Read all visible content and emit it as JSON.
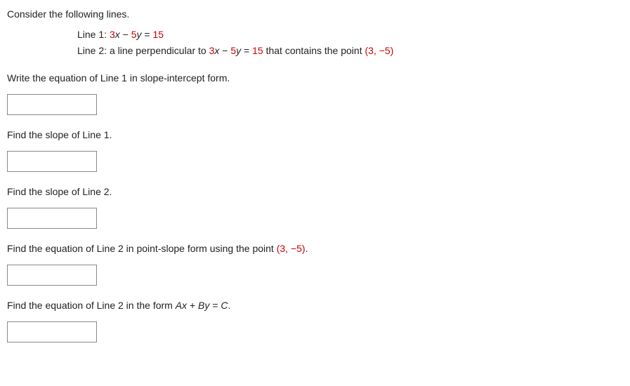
{
  "intro": "Consider the following lines.",
  "lines": {
    "line1": {
      "label": "Line 1: ",
      "eq_pre_num1": "3",
      "eq_var1": "x",
      "eq_mid": " − ",
      "eq_pre_num2": "5",
      "eq_var2": "y",
      "eq_eqs": " = ",
      "eq_rhs": "15"
    },
    "line2": {
      "label": "Line 2: ",
      "text_a": "a line perpendicular to ",
      "eq_pre_num1": "3",
      "eq_var1": "x",
      "eq_mid": " − ",
      "eq_pre_num2": "5",
      "eq_var2": "y",
      "eq_eqs": " = ",
      "eq_rhs": "15",
      "text_b": " that contains the point ",
      "pt_open": "(",
      "pt_x": "3",
      "pt_sep": ", ",
      "pt_y": "−5",
      "pt_close": ")"
    }
  },
  "q1": "Write the equation of Line 1 in slope-intercept form.",
  "q2": "Find the slope of Line 1.",
  "q3": "Find the slope of Line 2.",
  "q4": {
    "pre": "Find the equation of Line 2 in point-slope form using the point ",
    "pt_open": "(",
    "pt_x": "3",
    "pt_sep": ", ",
    "pt_y": "−5",
    "pt_close": ")",
    "end": "."
  },
  "q5": {
    "pre": "Find the equation of Line 2 in the form ",
    "varA": "Ax",
    "plus": " + ",
    "varB": "By",
    "eqs": " = ",
    "varC": "C",
    "end": "."
  }
}
